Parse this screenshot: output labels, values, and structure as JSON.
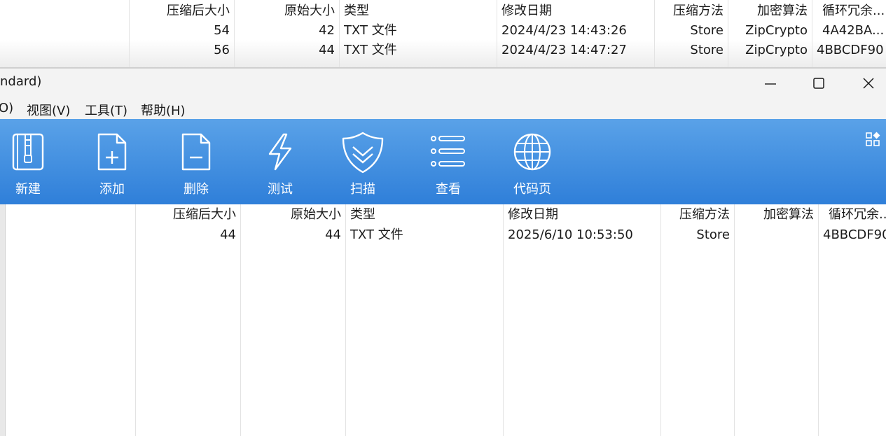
{
  "background_window": {
    "columns": [
      "压缩后大小",
      "原始大小",
      "类型",
      "修改日期",
      "压缩方法",
      "加密算法",
      "循环冗余..."
    ],
    "rows": [
      {
        "packed": "54",
        "size": "42",
        "type": "TXT 文件",
        "modified": "2024/4/23 14:43:26",
        "method": "Store",
        "encryption": "ZipCrypto",
        "crc": "4A42BA..."
      },
      {
        "packed": "56",
        "size": "44",
        "type": "TXT 文件",
        "modified": "2024/4/23 14:47:27",
        "method": "Store",
        "encryption": "ZipCrypto",
        "crc": "4BBCDF90"
      }
    ]
  },
  "window": {
    "title": "ndard)",
    "controls": {
      "minimize": "minimize-icon",
      "maximize": "maximize-icon",
      "close": "close-icon"
    }
  },
  "menu": {
    "items": [
      "O)",
      "视图(V)",
      "工具(T)",
      "帮助(H)"
    ]
  },
  "toolbar": {
    "buttons": [
      {
        "label": "新建",
        "icon": "archive-zip-icon"
      },
      {
        "label": "添加",
        "icon": "file-add-icon"
      },
      {
        "label": "删除",
        "icon": "file-remove-icon"
      },
      {
        "label": "测试",
        "icon": "lightning-icon"
      },
      {
        "label": "扫描",
        "icon": "shield-icon"
      },
      {
        "label": "查看",
        "icon": "list-icon"
      },
      {
        "label": "代码页",
        "icon": "globe-icon"
      }
    ],
    "layout_icon": "grid-layout-icon"
  },
  "file_list": {
    "columns": [
      "压缩后大小",
      "原始大小",
      "类型",
      "修改日期",
      "压缩方法",
      "加密算法",
      "循环冗余..."
    ],
    "rows": [
      {
        "packed": "44",
        "size": "44",
        "type": "TXT 文件",
        "modified": "2025/6/10 10:53:50",
        "method": "Store",
        "encryption": "",
        "crc": "4BBCDF90"
      }
    ]
  },
  "colors": {
    "toolbar_top": "#5aa2e8",
    "toolbar_bottom": "#2f7fd9",
    "titlebar": "#f3f3f3"
  }
}
